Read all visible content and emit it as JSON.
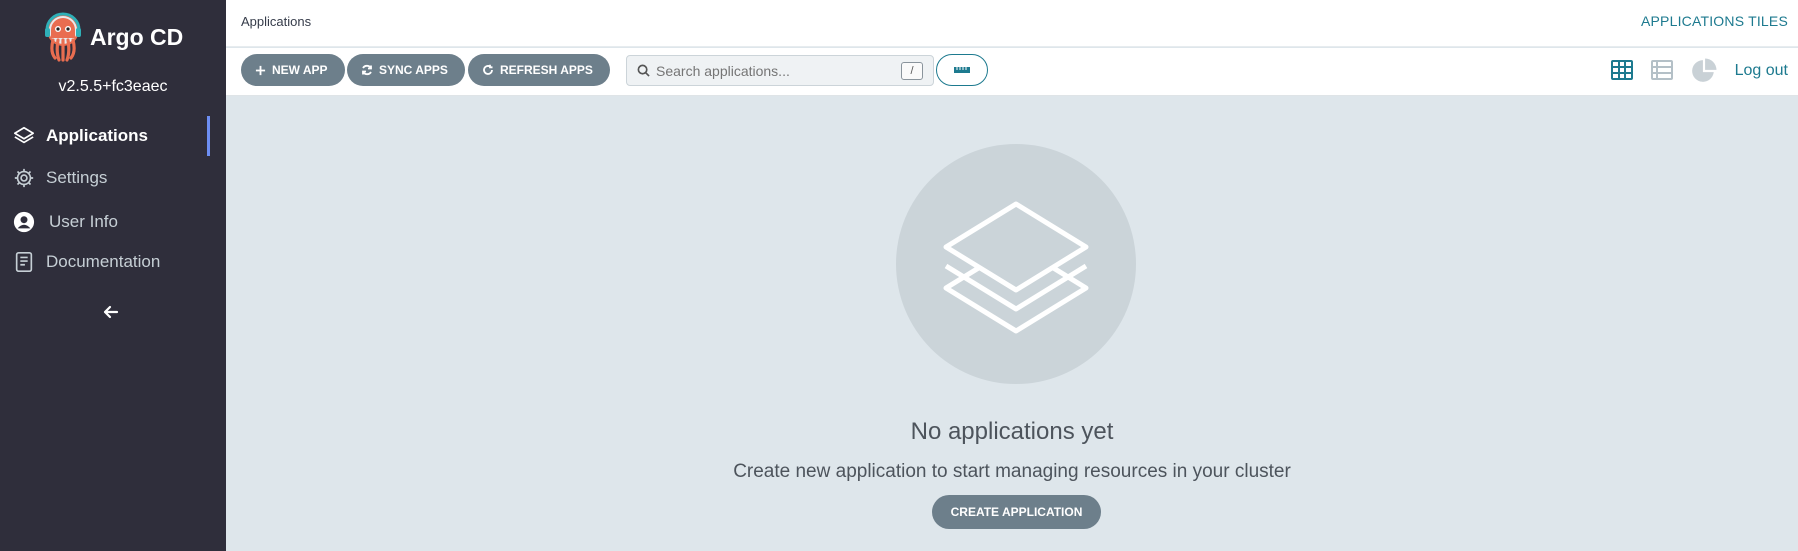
{
  "app": {
    "name": "Argo CD",
    "version": "v2.5.5+fc3eaec"
  },
  "sidebar": {
    "items": [
      {
        "label": "Applications",
        "icon": "layers-icon",
        "active": true
      },
      {
        "label": "Settings",
        "icon": "gear-icon",
        "active": false
      },
      {
        "label": "User Info",
        "icon": "user-circle-icon",
        "active": false
      },
      {
        "label": "Documentation",
        "icon": "book-icon",
        "active": false
      }
    ],
    "collapse_icon": "arrow-left-icon"
  },
  "header": {
    "breadcrumb": "Applications",
    "view_title": "APPLICATIONS TILES"
  },
  "toolbar": {
    "new_app": "NEW APP",
    "sync_apps": "SYNC APPS",
    "refresh_apps": "REFRESH APPS",
    "search_placeholder": "Search applications...",
    "search_shortcut": "/",
    "logout": "Log out",
    "views": [
      "tiles",
      "list",
      "summary"
    ],
    "active_view": "tiles"
  },
  "empty_state": {
    "title": "No applications yet",
    "subtitle": "Create new application to start managing resources in your cluster",
    "button": "CREATE APPLICATION"
  },
  "colors": {
    "sidebar_bg": "#2f2e3b",
    "accent": "#1d7a8f",
    "button_bg": "#6d7f8b",
    "content_bg": "#dee6eb",
    "active_indicator": "#6d8ef3"
  }
}
